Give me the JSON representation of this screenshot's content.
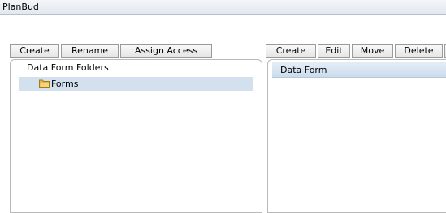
{
  "window": {
    "title": "PlanBud"
  },
  "left_toolbar": {
    "create_label": "Create",
    "rename_label": "Rename",
    "assign_access_label": "Assign Access"
  },
  "right_toolbar": {
    "create_label": "Create",
    "edit_label": "Edit",
    "move_label": "Move",
    "delete_label": "Delete"
  },
  "folders_panel": {
    "heading": "Data Form Folders",
    "items": [
      {
        "label": "Forms",
        "icon": "folder-icon",
        "selected": true
      }
    ]
  },
  "forms_panel": {
    "column_header": "Data Form"
  },
  "colors": {
    "selection": "#d3e1ee",
    "header_bg": "#ccdced",
    "folder": "#e8b84a"
  }
}
